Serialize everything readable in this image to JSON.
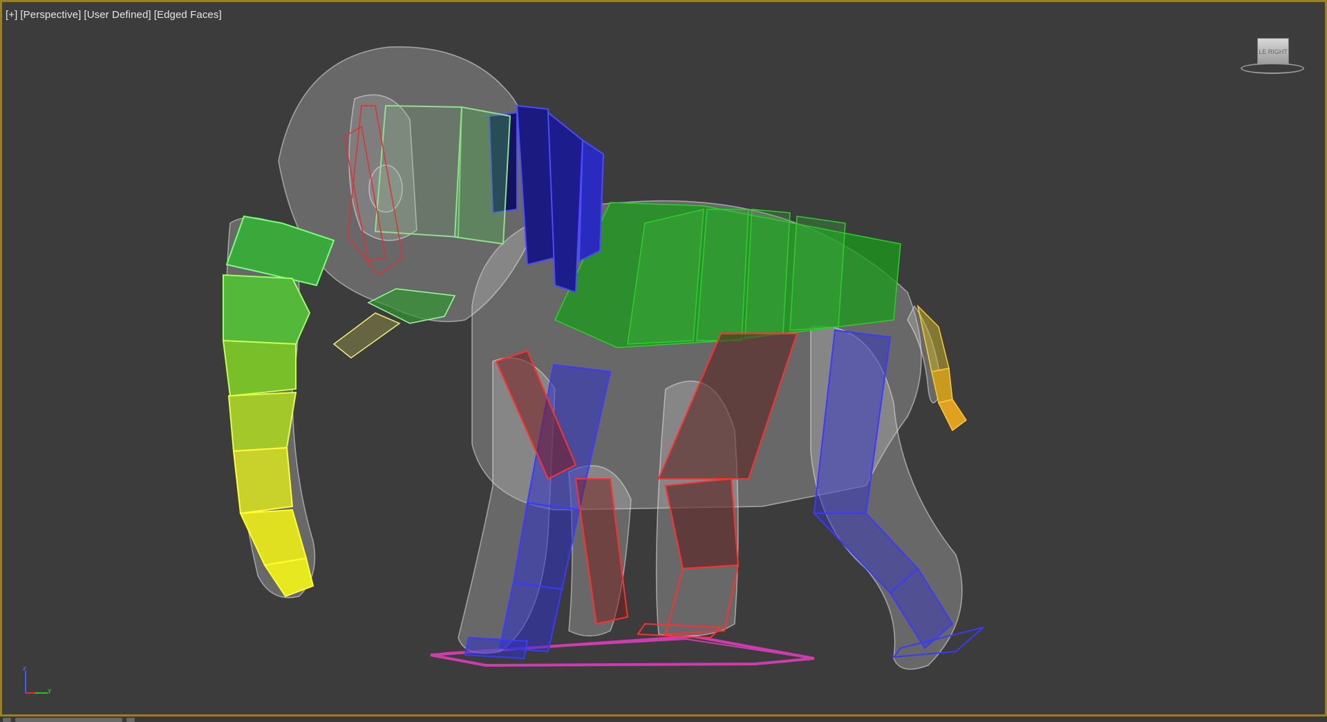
{
  "viewport": {
    "label_parts": [
      "[+]",
      "[Perspective]",
      "[User Defined]",
      "[Edged Faces]"
    ],
    "border_color": "#9a7f2a",
    "background_color": "#3c3c3c"
  },
  "viewcube": {
    "face_labels": [
      "LE",
      "RIGHT"
    ],
    "icon": "viewcube-icon"
  },
  "axis_tripod": {
    "z_label": "z",
    "y_label": "y",
    "icon": "axis-tripod-icon"
  },
  "scene": {
    "model": "elephant-mesh-icon",
    "rig_colors": {
      "trunk_top": "#3aa83a",
      "trunk_mid": "#7fbf2a",
      "trunk_tip": "#e0e020",
      "head": "#49a849",
      "neck": "#1c1c8a",
      "spine": "#1f9a1f",
      "legs_right": "#3232c8",
      "legs_left": "#c83232",
      "tail": "#e0a020",
      "ground_shape": "#d03cb0"
    }
  }
}
